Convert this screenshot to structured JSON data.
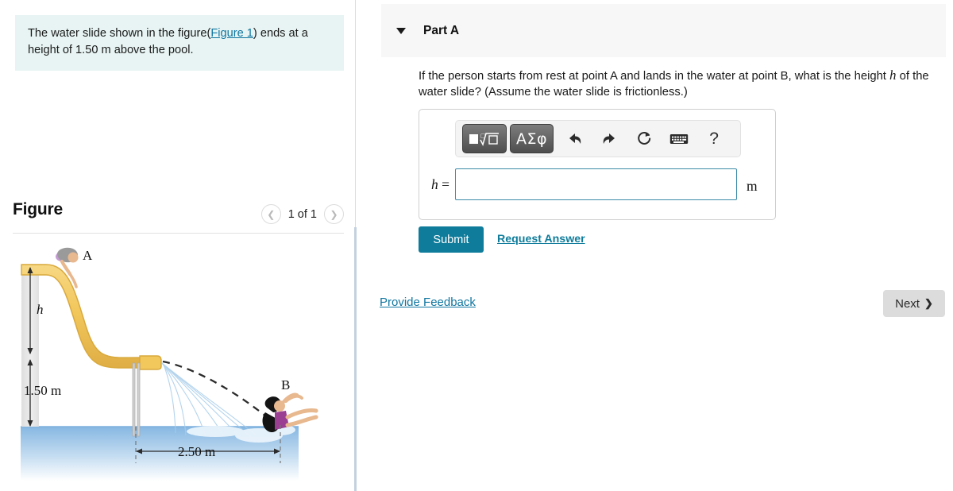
{
  "problem": {
    "text_before_link": "The water slide shown in the figure(",
    "link_label": "Figure 1",
    "text_after_link": ") ends at a height of 1.50 m above the pool."
  },
  "figure_panel": {
    "title": "Figure",
    "pager": {
      "prev_icon": "chevron-left-icon",
      "label": "1 of 1",
      "next_icon": "chevron-right-icon"
    }
  },
  "figure": {
    "point_a_label": "A",
    "point_b_label": "B",
    "height_label": "h",
    "lower_height_label": "1.50 m",
    "horizontal_label": "2.50 m",
    "colors": {
      "slide": "#f2c75c",
      "slide_edge": "#d9a93c",
      "tower": "#e8e8e8",
      "water_top": "#86b7e2",
      "water_bottom": "#ffffff",
      "trajectory": "#2b2b2b",
      "spray": "#a8cdea",
      "swimsuit_a": "#c49ad4",
      "swimsuit_b": "#9b3f93",
      "hair_a": "#9a9a9a",
      "hair_b": "#141414",
      "skin": "#e8b88f"
    }
  },
  "part": {
    "caret_icon": "chevron-down-icon",
    "label": "Part A",
    "question_before_var": "If the person starts from rest at point A and lands in the water at point B, what is the height ",
    "question_var": "h",
    "question_after_var": " of the water slide? (Assume the water slide is frictionless.)"
  },
  "answer": {
    "toolbar": [
      {
        "name": "math-template-button",
        "label": ""
      },
      {
        "name": "greek-letters-button",
        "label": "ΑΣφ"
      },
      {
        "name": "undo-icon",
        "label": ""
      },
      {
        "name": "redo-icon",
        "label": ""
      },
      {
        "name": "reset-icon",
        "label": ""
      },
      {
        "name": "keyboard-icon",
        "label": ""
      },
      {
        "name": "help-icon",
        "label": "?"
      }
    ],
    "greek_label": "ΑΣφ",
    "help_label": "?",
    "variable": "h",
    "equals": " =",
    "value": "",
    "placeholder": "",
    "unit": "m"
  },
  "actions": {
    "submit_label": "Submit",
    "request_answer_label": "Request Answer",
    "provide_feedback_label": "Provide Feedback",
    "next_label": "Next",
    "next_icon": "chevron-right-icon"
  },
  "colors": {
    "accent_teal": "#0f7c9b",
    "link_blue": "#1076a0",
    "statement_bg": "#e7f4f3",
    "part_header_bg": "#f7f7f7"
  }
}
